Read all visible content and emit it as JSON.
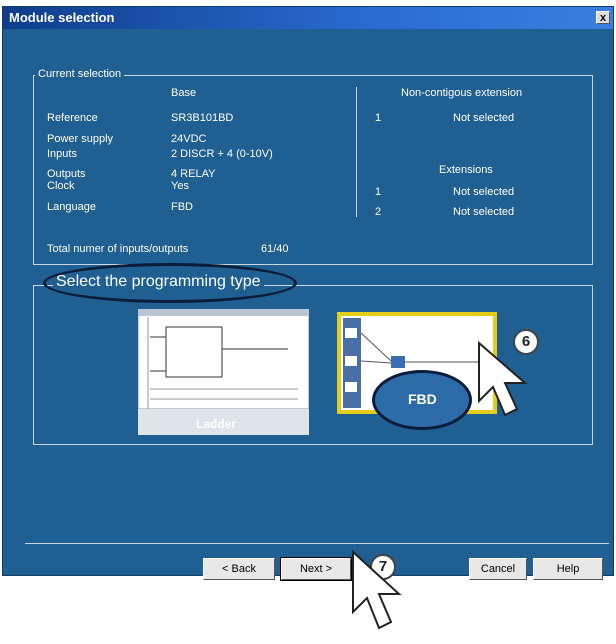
{
  "window": {
    "title": "Module selection",
    "close_label": "x"
  },
  "current_selection": {
    "legend": "Current selection",
    "base_header": "Base",
    "rows": [
      {
        "label": "Reference",
        "value": "SR3B101BD"
      },
      {
        "label": "Power supply",
        "value": "24VDC"
      },
      {
        "label": "Inputs",
        "value": "2 DISCR + 4 (0-10V)"
      },
      {
        "label": "Outputs",
        "value": "4 RELAY"
      },
      {
        "label": "Clock",
        "value": "Yes"
      },
      {
        "label": "Language",
        "value": "FBD"
      }
    ],
    "noncontig_header": "Non-contigous extension",
    "noncontig": [
      {
        "num": "1",
        "value": "Not selected"
      }
    ],
    "extensions_header": "Extensions",
    "extensions": [
      {
        "num": "1",
        "value": "Not selected"
      },
      {
        "num": "2",
        "value": "Not selected"
      }
    ],
    "total_label": "Total numer of inputs/outputs",
    "total_value": "61/40"
  },
  "programming": {
    "legend": "Select the programming type",
    "ladder_label": "Ladder",
    "fbd_label": "FBD"
  },
  "buttons": {
    "back": "< Back",
    "next": "Next >",
    "cancel": "Cancel",
    "help": "Help"
  },
  "callouts": {
    "step6": "6",
    "step7": "7"
  }
}
